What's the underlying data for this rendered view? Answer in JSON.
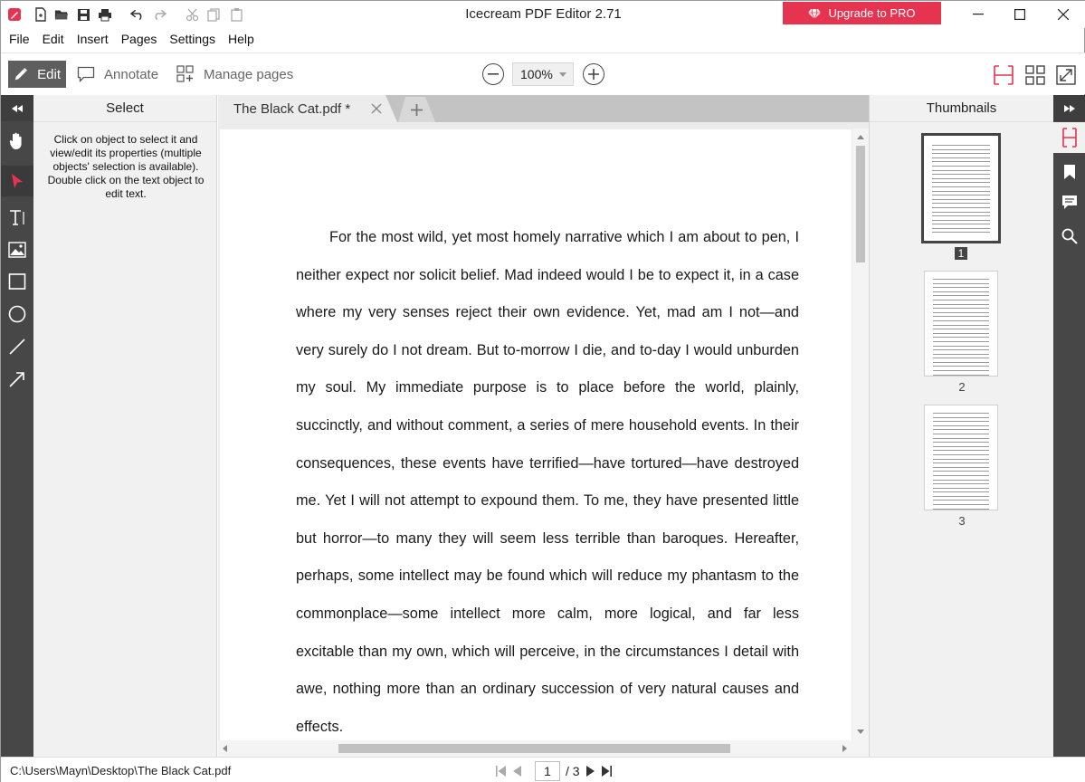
{
  "window": {
    "title": "Icecream PDF Editor 2.71",
    "upgrade_label": "Upgrade to PRO",
    "accent": "#e6334f"
  },
  "quick_access": [
    "app-logo-icon",
    "new-file-icon",
    "open-folder-icon",
    "save-icon",
    "print-icon",
    "undo-icon",
    "redo-icon",
    "cut-icon",
    "copy-icon",
    "paste-icon"
  ],
  "menu": [
    "File",
    "Edit",
    "Insert",
    "Pages",
    "Settings",
    "Help"
  ],
  "toolbar": {
    "modes": [
      {
        "label": "Edit",
        "icon": "pencil-icon",
        "active": true
      },
      {
        "label": "Annotate",
        "icon": "comment-icon",
        "active": false
      },
      {
        "label": "Manage pages",
        "icon": "manage-pages-icon",
        "active": false
      }
    ],
    "zoom": "100%"
  },
  "left_panel": {
    "title": "Select",
    "help": "Click on object to select it and view/edit its properties (multiple objects' selection is available). Double click on the text object to edit text.",
    "tools": [
      "hand-icon",
      "select-arrow-icon",
      "text-tool-icon",
      "image-tool-icon",
      "rectangle-tool-icon",
      "ellipse-tool-icon",
      "line-tool-icon",
      "arrow-tool-icon"
    ],
    "selected_tool": "select-arrow-icon"
  },
  "tabs": [
    {
      "label": "The Black Cat.pdf *"
    }
  ],
  "document": {
    "paragraph": "For the most wild, yet most homely narrative which I am about to pen, I neither expect nor solicit belief. Mad indeed would I be to expect it, in a case where my very senses reject their own evidence. Yet, mad am I not—and very surely do I not dream. But to-morrow I die, and to-day I would unburden my soul. My immediate purpose is to place before the world, plainly, succinctly, and without comment, a series of mere household events. In their consequences, these events have terrified—have tortured—have destroyed me. Yet I will not attempt to expound them. To me, they have presented little but horror—to many they will seem less terrible than baroques. Hereafter, perhaps, some intellect may be found which will reduce my phantasm to the commonplace—some intellect more calm, more logical, and far less excitable than my own, which will perceive, in the circumstances I detail with awe, nothing more than an ordinary succession of very natural causes and effects."
  },
  "thumbnails": {
    "title": "Thumbnails",
    "pages": [
      {
        "number": "1",
        "current": true
      },
      {
        "number": "2",
        "current": false
      },
      {
        "number": "3",
        "current": false
      }
    ]
  },
  "right_strip": [
    "thumbnails-icon",
    "bookmark-icon",
    "comments-icon",
    "search-icon"
  ],
  "status": {
    "path": "C:\\Users\\Mayn\\Desktop\\The Black Cat.pdf",
    "current_page": "1",
    "total_pages": "/ 3"
  }
}
